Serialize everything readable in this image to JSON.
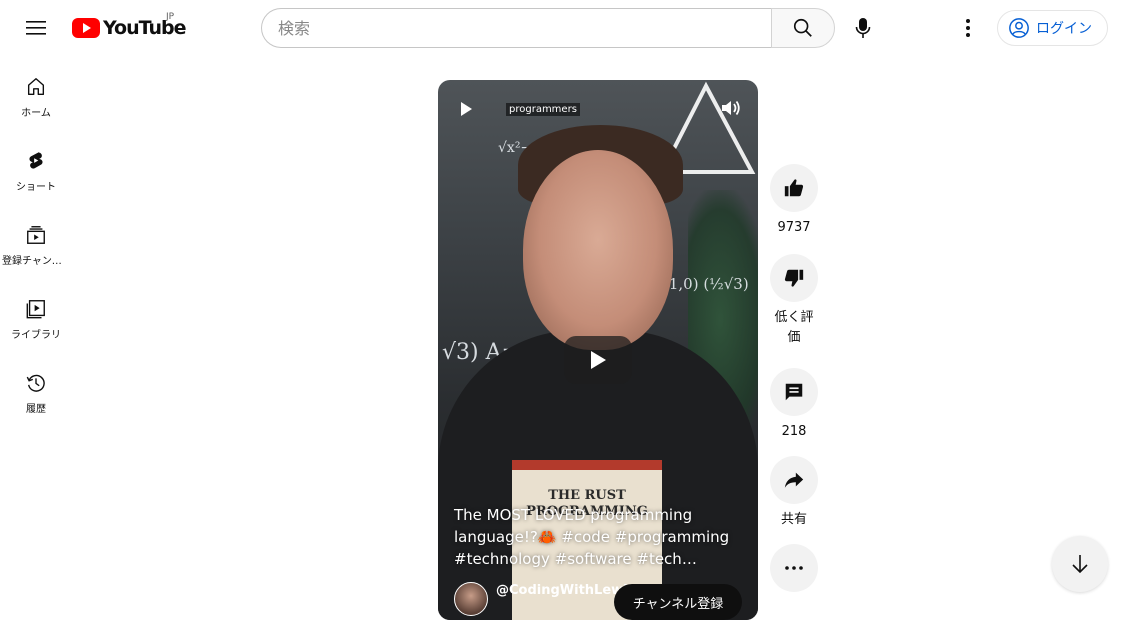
{
  "header": {
    "logo_text": "YouTube",
    "region": "JP",
    "search_placeholder": "検索",
    "login_label": "ログイン"
  },
  "sidebar": {
    "items": [
      {
        "label": "ホーム",
        "icon": "home-icon"
      },
      {
        "label": "ショート",
        "icon": "shorts-icon"
      },
      {
        "label": "登録チャンネル",
        "icon": "subscriptions-icon"
      },
      {
        "label": "ライブラリ",
        "icon": "library-icon"
      },
      {
        "label": "履歴",
        "icon": "history-icon"
      }
    ]
  },
  "video": {
    "tag": "programmers",
    "book_title_line1": "THE RUST",
    "book_title_line2": "PROGRAMMING",
    "caption": "The MOST LOVED programming language!?🦀 #code #programming #technology #software #tech…",
    "channel": "@CodingWithLewi",
    "subscribe_label": "チャンネル登録"
  },
  "actions": {
    "likes": "9737",
    "dislike_label": "低く評価",
    "comments": "218",
    "share_label": "共有"
  },
  "colors": {
    "brand_red": "#ff0000",
    "link_blue": "#065fd4",
    "button_gray": "#f2f2f2"
  }
}
